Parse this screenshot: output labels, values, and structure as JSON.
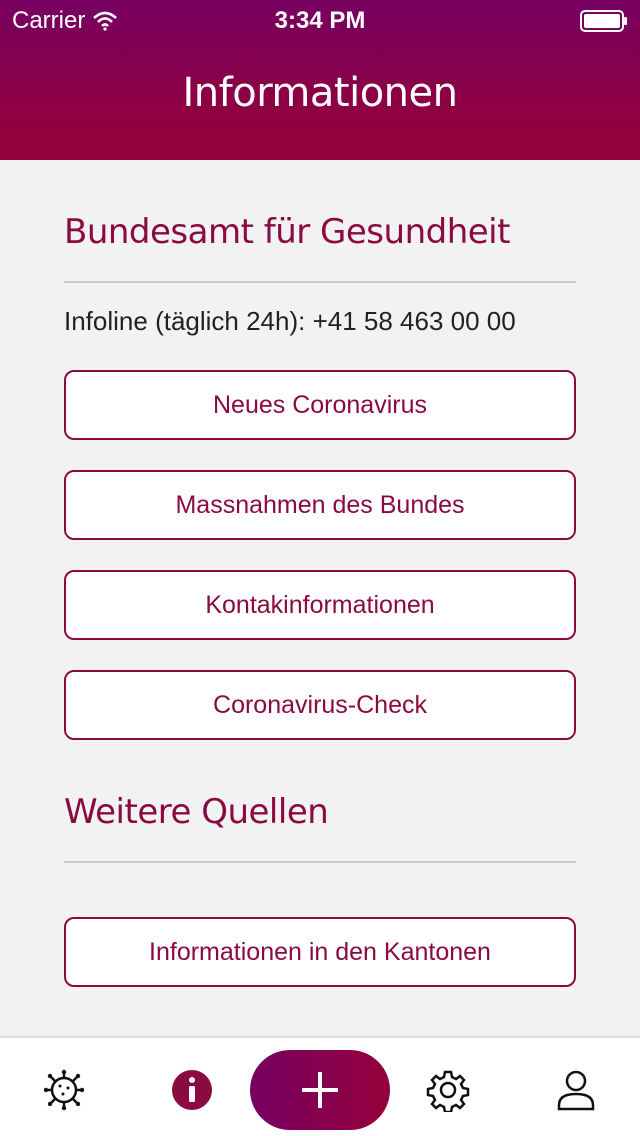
{
  "status_bar": {
    "carrier": "Carrier",
    "time": "3:34 PM"
  },
  "header": {
    "title": "Informationen"
  },
  "section_bag": {
    "heading": "Bundesamt für Gesundheit",
    "infoline": "Infoline (täglich 24h): +41 58 463 00 00",
    "buttons": [
      "Neues Coronavirus",
      "Massnahmen des Bundes",
      "Kontakinformationen",
      "Coronavirus-Check"
    ]
  },
  "section_more": {
    "heading": "Weitere Quellen",
    "buttons": [
      "Informationen in den Kantonen"
    ]
  },
  "tabbar": {
    "icons": [
      "virus-icon",
      "info-icon",
      "plus-icon",
      "gear-icon",
      "person-icon"
    ],
    "active": "info-icon"
  },
  "colors": {
    "accent": "#8a0a42",
    "header_top": "#760062",
    "header_bottom": "#95003a"
  }
}
